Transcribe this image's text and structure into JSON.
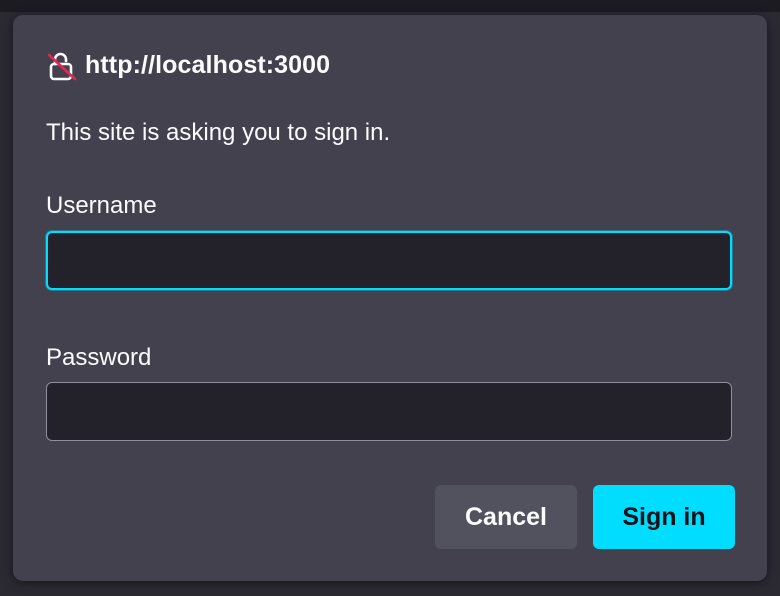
{
  "dialog": {
    "origin": "http://localhost:3000",
    "message": "This site is asking you to sign in.",
    "lock_icon": "insecure-lock-icon",
    "username": {
      "label": "Username",
      "value": "",
      "placeholder": ""
    },
    "password": {
      "label": "Password",
      "value": "",
      "placeholder": ""
    },
    "buttons": {
      "cancel": "Cancel",
      "sign_in": "Sign in"
    }
  },
  "colors": {
    "accent": "#00ddff",
    "dialog_background": "#42414d",
    "field_background": "#23222b",
    "insecure_strike": "#e22850",
    "text": "#fbfbfe"
  }
}
